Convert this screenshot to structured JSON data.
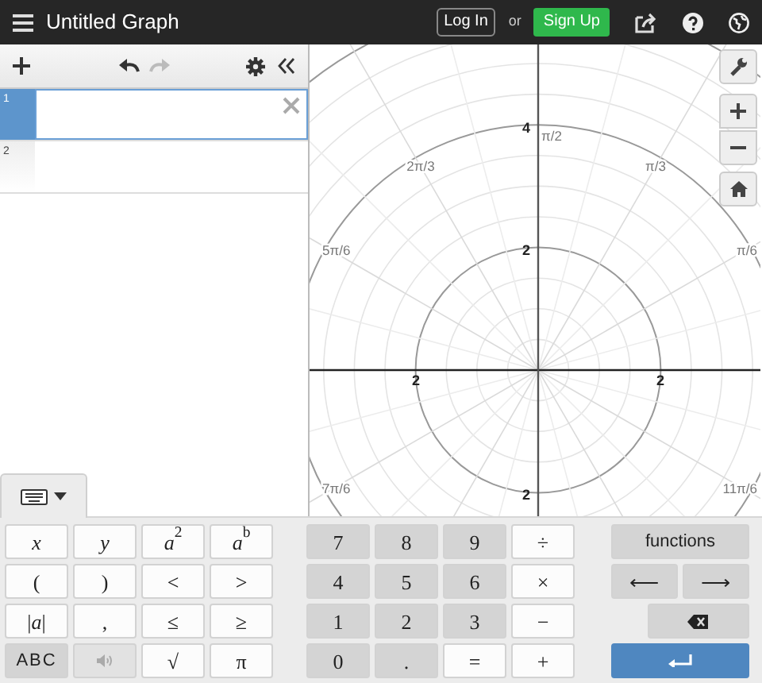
{
  "header": {
    "title": "Untitled Graph",
    "login": "Log In",
    "or": "or",
    "signup": "Sign Up"
  },
  "expressions": [
    {
      "index": "1",
      "selected": true
    },
    {
      "index": "2",
      "selected": false
    }
  ],
  "graph": {
    "axis_labels": [
      "4",
      "2",
      "2",
      "2",
      "2"
    ],
    "angle_labels": [
      "π/6",
      "π/3",
      "π/2",
      "2π/3",
      "5π/6",
      "7π/6",
      "11π/6"
    ]
  },
  "keypad": {
    "groups": [
      [
        {
          "label": "x",
          "kind": "light",
          "italic": true
        },
        {
          "label": "y",
          "kind": "light",
          "italic": true
        },
        {
          "label": "*a*$^{2}$",
          "kind": "light",
          "italic": false
        },
        {
          "label": "*a*$^{b}$",
          "kind": "light",
          "italic": false
        },
        {
          "label": "(",
          "kind": "light",
          "italic": false
        },
        {
          "label": ")",
          "kind": "light",
          "italic": false
        },
        {
          "label": "<",
          "kind": "light",
          "italic": false
        },
        {
          "label": ">",
          "kind": "light",
          "italic": false
        },
        {
          "label": "|*a*|",
          "kind": "light",
          "italic": false
        },
        {
          "label": ",",
          "kind": "light",
          "italic": false
        },
        {
          "label": "≤",
          "kind": "light",
          "italic": false
        },
        {
          "label": "≥",
          "kind": "light",
          "italic": false
        },
        {
          "label": "ABC",
          "kind": "dark",
          "italic": false
        },
        {
          "kind": "speaker"
        },
        {
          "label": "√",
          "kind": "light"
        },
        {
          "label": "π",
          "kind": "light",
          "italic": false
        }
      ],
      [
        {
          "label": "7",
          "kind": "dark",
          "italic": false
        },
        {
          "label": "8",
          "kind": "dark",
          "italic": false
        },
        {
          "label": "9",
          "kind": "dark",
          "italic": false
        },
        {
          "label": "÷",
          "kind": "light",
          "italic": false
        },
        {
          "label": "4",
          "kind": "dark",
          "italic": false
        },
        {
          "label": "5",
          "kind": "dark",
          "italic": false
        },
        {
          "label": "6",
          "kind": "dark",
          "italic": false
        },
        {
          "label": "×",
          "kind": "light",
          "italic": false
        },
        {
          "label": "1",
          "kind": "dark",
          "italic": false
        },
        {
          "label": "2",
          "kind": "dark",
          "italic": false
        },
        {
          "label": "3",
          "kind": "dark",
          "italic": false
        },
        {
          "label": "−",
          "kind": "light"
        },
        {
          "label": "0",
          "kind": "dark",
          "italic": false
        },
        {
          "label": ".",
          "kind": "dark",
          "italic": false
        },
        {
          "label": "=",
          "kind": "light",
          "italic": false
        },
        {
          "label": "+",
          "kind": "light",
          "italic": false
        }
      ],
      [
        {
          "label": "functions",
          "kind": "wide",
          "italic": false
        },
        {
          "label": "⟵",
          "kind": "dark",
          "italic": false
        },
        {
          "label": "⟶",
          "kind": "dark",
          "italic": false
        },
        {
          "kind": "backspace"
        },
        {
          "kind": "enter"
        }
      ]
    ]
  }
}
